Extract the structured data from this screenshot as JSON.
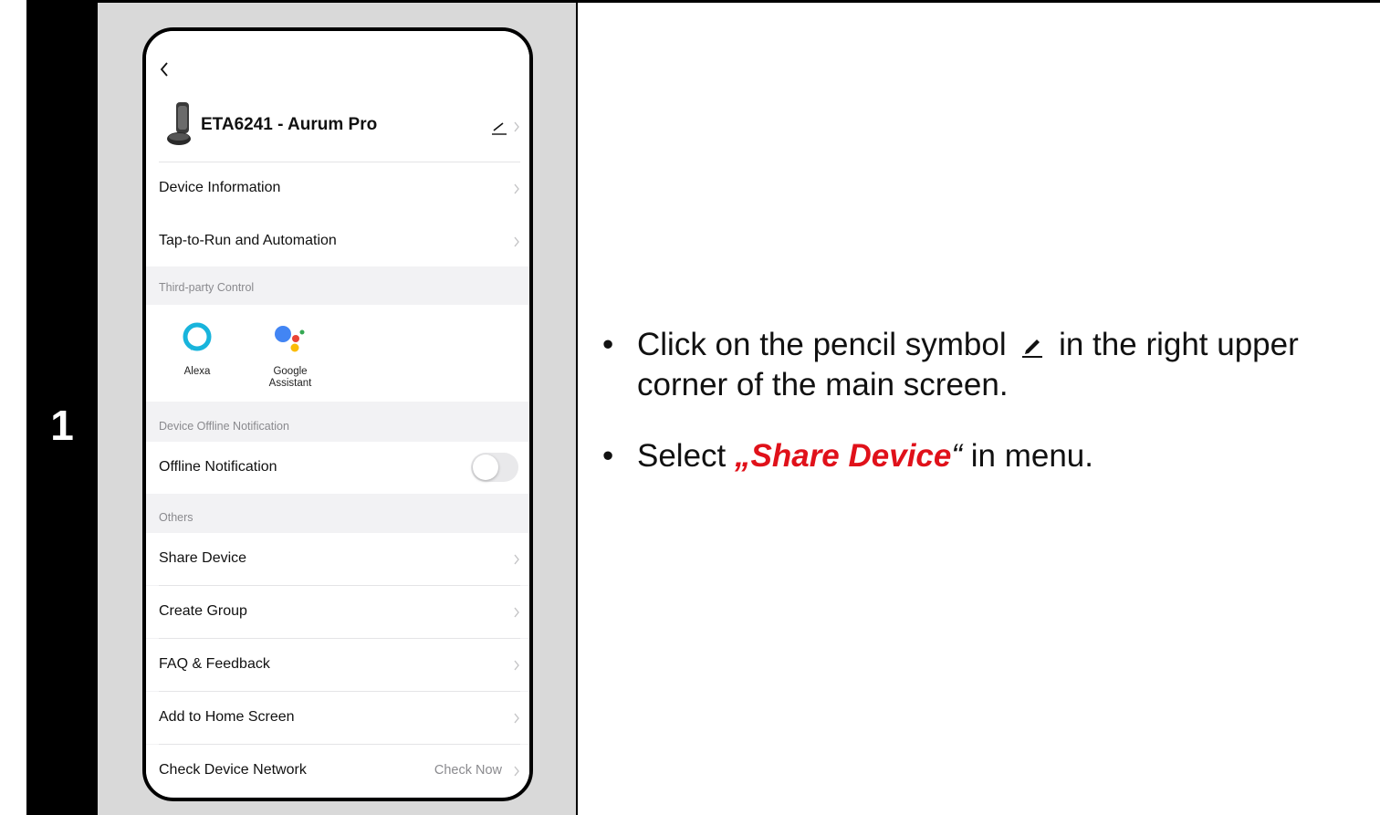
{
  "step": {
    "number": "1"
  },
  "phone": {
    "device": {
      "name": "ETA6241 - Aurum Pro"
    },
    "menu_top": [
      {
        "label": "Device Information"
      },
      {
        "label": "Tap-to-Run and Automation"
      }
    ],
    "sections": {
      "third_party": "Third-party Control",
      "offline": "Device Offline Notification",
      "others": "Others"
    },
    "third_party": {
      "alexa": "Alexa",
      "google_line1": "Google",
      "google_line2": "Assistant"
    },
    "offline_notification": {
      "label": "Offline Notification",
      "enabled": false
    },
    "menu_others": [
      {
        "label": "Share Device"
      },
      {
        "label": "Create Group"
      },
      {
        "label": "FAQ & Feedback"
      },
      {
        "label": "Add to Home Screen"
      },
      {
        "label": "Check Device Network"
      }
    ],
    "check_now": "Check Now",
    "colors": {
      "screen_bg": "#f2f2f4",
      "alexa": "#18b4dc",
      "google_blue": "#4285f4",
      "google_red": "#ea4335",
      "google_yellow": "#fbbc05",
      "google_green": "#34a853"
    }
  },
  "instructions": {
    "bullet": "•",
    "line1_before": "Click on the pencil symbol",
    "line1_after": "in the right upper corner of the main screen.",
    "line2_before": "Select ",
    "line2_open_quote": "„",
    "line2_highlight": "Share Device",
    "line2_close_quote": "“",
    "line2_after": " in menu.",
    "highlight_color": "#e0111a",
    "pencil_icon": "pencil-icon"
  }
}
